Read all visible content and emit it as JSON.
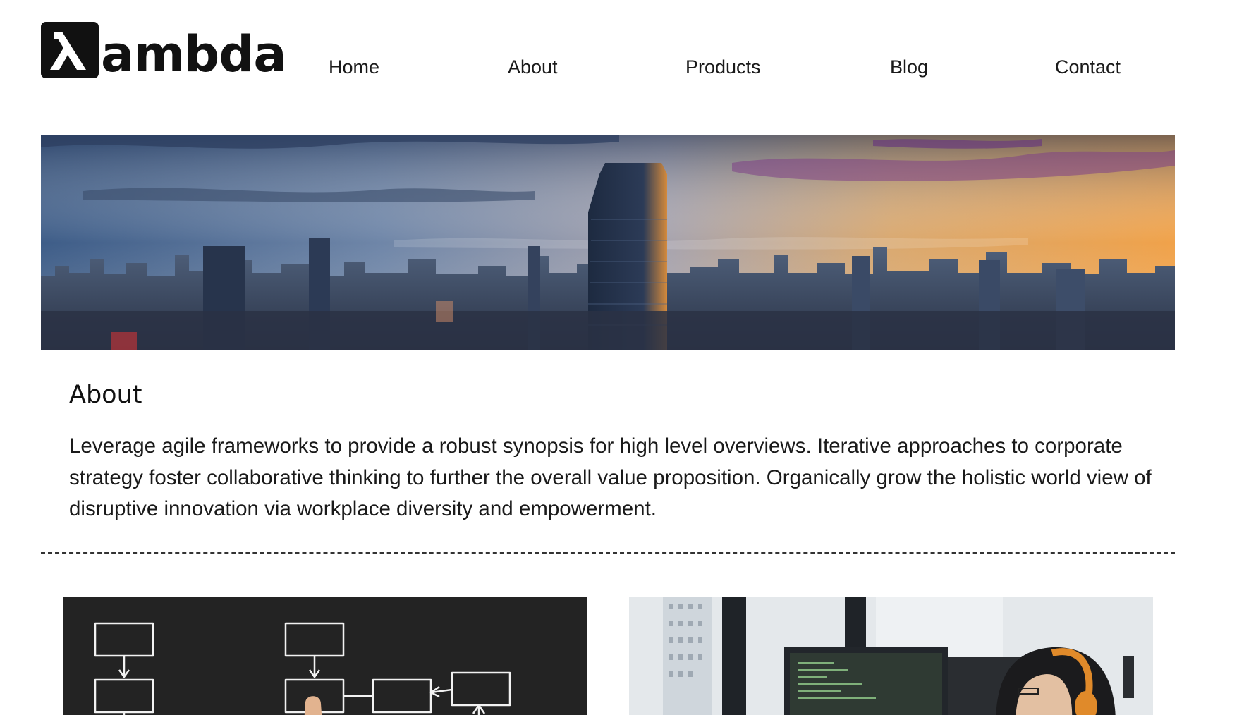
{
  "brand": {
    "name": "ambda",
    "mark_glyph": "λ"
  },
  "nav": {
    "items": [
      "Home",
      "About",
      "Products",
      "Blog",
      "Contact"
    ]
  },
  "hero": {
    "image": "city-skyline-sunset"
  },
  "about": {
    "title": "About",
    "body": "Leverage agile frameworks to provide a robust synopsis for high level overviews. Iterative approaches to corporate strategy foster collaborative thinking to further the overall value proposition. Organically grow the holistic world view of disruptive innovation via workplace diversity and empowerment."
  },
  "thumbnails": [
    {
      "image": "flowchart-chalkboard-hand"
    },
    {
      "image": "developer-with-headphones-at-monitors"
    }
  ],
  "colors": {
    "text": "#1a1a1a",
    "logo": "#111111",
    "background": "#ffffff"
  }
}
